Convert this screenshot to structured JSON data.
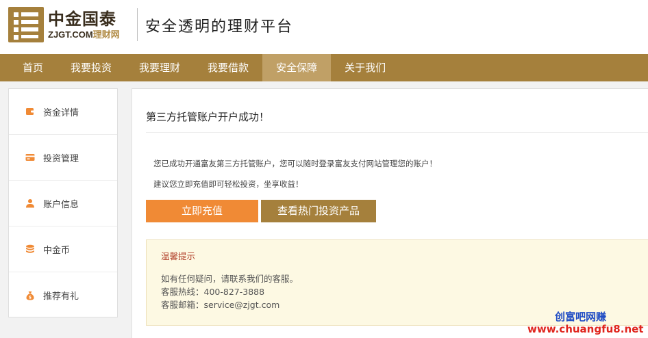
{
  "header": {
    "logo_cn": "中金国泰",
    "logo_en_main": "ZJGT.COM",
    "logo_en_accent": "理财网",
    "slogan": "安全透明的理财平台"
  },
  "nav": {
    "items": [
      "首页",
      "我要投资",
      "我要理财",
      "我要借款",
      "安全保障",
      "关于我们"
    ],
    "active": "安全保障"
  },
  "sidebar": {
    "items": [
      {
        "label": "资金详情",
        "icon": "wallet-icon"
      },
      {
        "label": "投资管理",
        "icon": "card-icon"
      },
      {
        "label": "账户信息",
        "icon": "user-icon"
      },
      {
        "label": "中金币",
        "icon": "coin-stack-icon"
      },
      {
        "label": "推荐有礼",
        "icon": "money-bag-icon"
      }
    ]
  },
  "main": {
    "title": "第三方托管账户开户成功！",
    "message1": "您已成功开通富友第三方托管账户，您可以随时登录富友支付网站管理您的账户！",
    "message2": "建议您立即充值即可轻松投资，坐享收益！",
    "btn_recharge": "立即充值",
    "btn_products": "查看热门投资产品",
    "tip": {
      "title": "温馨提示",
      "line1": "如有任何疑问，请联系我们的客服。",
      "line2": "客服热线：400-827-3888",
      "line3": "客服邮箱：service@zjgt.com"
    }
  },
  "watermark": {
    "line1": "创富吧网赚",
    "line2": "www.chuangfu8.net"
  },
  "colors": {
    "brand": "#a5803c",
    "nav_active": "#c0a066",
    "accent_orange": "#f08a35",
    "tip_bg": "#fdf9e3",
    "tip_title": "#b3442e"
  }
}
